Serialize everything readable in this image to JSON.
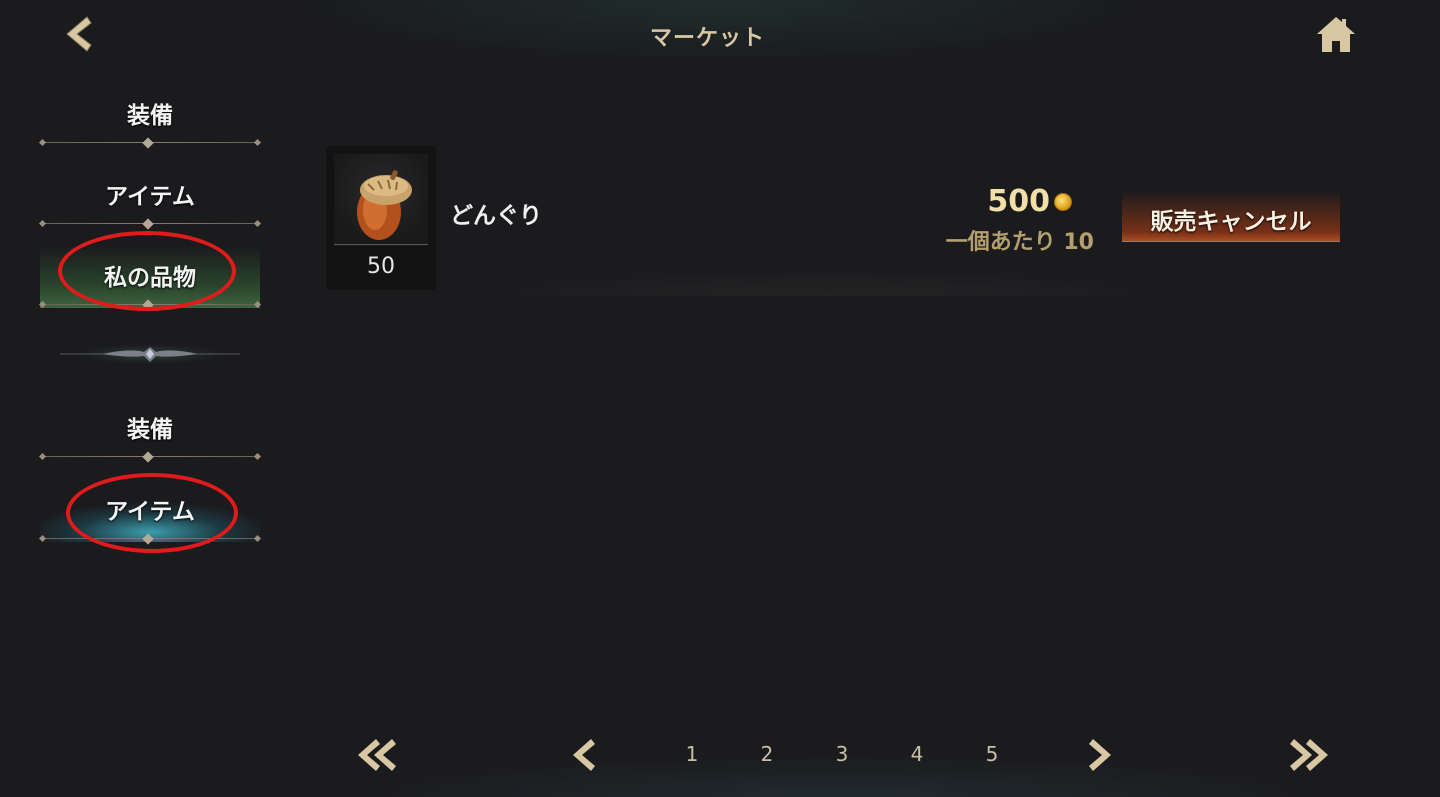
{
  "header": {
    "title": "マーケット",
    "back_icon": "chevron-left-icon",
    "home_icon": "home-icon"
  },
  "sidebar": {
    "sections": [
      {
        "items": [
          {
            "label": "装備"
          },
          {
            "label": "アイテム"
          },
          {
            "label": "私の品物",
            "active": true
          }
        ]
      },
      {
        "items": [
          {
            "label": "装備"
          },
          {
            "label": "アイテム",
            "active": true
          }
        ]
      }
    ]
  },
  "listing": {
    "item_name": "どんぐり",
    "quantity": "50",
    "item_icon": "acorn-icon",
    "total_price": "500",
    "currency_icon": "gold-coin-icon",
    "unit_price_text": "一個あたり 10",
    "cancel_label": "販売キャンセル"
  },
  "pagination": {
    "first_icon": "double-chevron-left-icon",
    "prev_icon": "chevron-left-icon",
    "next_icon": "chevron-right-icon",
    "last_icon": "double-chevron-right-icon",
    "pages": [
      "1",
      "2",
      "3",
      "4",
      "5"
    ]
  },
  "colors": {
    "background": "#1b1b1e",
    "title": "#d9c7a4",
    "price": "#f3e0a8",
    "unit_price": "#b59f6e",
    "annotation": "#e01b1b"
  }
}
